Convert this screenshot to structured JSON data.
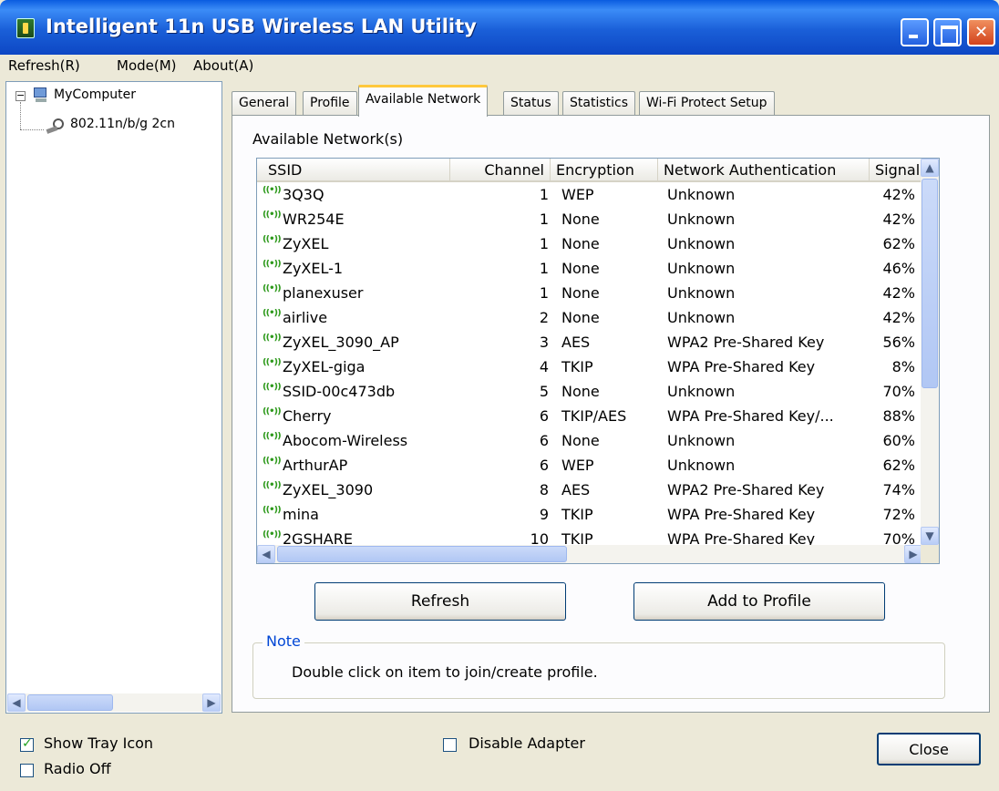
{
  "window": {
    "title": "Intelligent 11n USB Wireless LAN Utility"
  },
  "menu": {
    "items": [
      "Refresh(R)",
      "Mode(M)",
      "About(A)"
    ]
  },
  "tree": {
    "root_label": "MyComputer",
    "adapter_label": "802.11n/b/g 2cn",
    "expander_symbol": "−"
  },
  "tabs": [
    {
      "label": "General",
      "active": false
    },
    {
      "label": "Profile",
      "active": false
    },
    {
      "label": "Available Network",
      "active": true
    },
    {
      "label": "Status",
      "active": false
    },
    {
      "label": "Statistics",
      "active": false
    },
    {
      "label": "Wi-Fi Protect Setup",
      "active": false
    }
  ],
  "available": {
    "section_title": "Available Network(s)",
    "columns": [
      "SSID",
      "Channel",
      "Encryption",
      "Network Authentication",
      "Signal"
    ],
    "rows": [
      {
        "ssid": "3Q3Q",
        "channel": "1",
        "encryption": "WEP",
        "auth": "Unknown",
        "signal": "42%"
      },
      {
        "ssid": "WR254E",
        "channel": "1",
        "encryption": "None",
        "auth": "Unknown",
        "signal": "42%"
      },
      {
        "ssid": "ZyXEL",
        "channel": "1",
        "encryption": "None",
        "auth": "Unknown",
        "signal": "62%"
      },
      {
        "ssid": "ZyXEL-1",
        "channel": "1",
        "encryption": "None",
        "auth": "Unknown",
        "signal": "46%"
      },
      {
        "ssid": "planexuser",
        "channel": "1",
        "encryption": "None",
        "auth": "Unknown",
        "signal": "42%"
      },
      {
        "ssid": "airlive",
        "channel": "2",
        "encryption": "None",
        "auth": "Unknown",
        "signal": "42%"
      },
      {
        "ssid": "ZyXEL_3090_AP",
        "channel": "3",
        "encryption": "AES",
        "auth": "WPA2 Pre-Shared Key",
        "signal": "56%"
      },
      {
        "ssid": "ZyXEL-giga",
        "channel": "4",
        "encryption": "TKIP",
        "auth": "WPA Pre-Shared Key",
        "signal": "8%"
      },
      {
        "ssid": "SSID-00c473db",
        "channel": "5",
        "encryption": "None",
        "auth": "Unknown",
        "signal": "70%"
      },
      {
        "ssid": "Cherry",
        "channel": "6",
        "encryption": "TKIP/AES",
        "auth": "WPA Pre-Shared Key/...",
        "signal": "88%"
      },
      {
        "ssid": "Abocom-Wireless",
        "channel": "6",
        "encryption": "None",
        "auth": "Unknown",
        "signal": "60%"
      },
      {
        "ssid": "ArthurAP",
        "channel": "6",
        "encryption": "WEP",
        "auth": "Unknown",
        "signal": "62%"
      },
      {
        "ssid": "ZyXEL_3090",
        "channel": "8",
        "encryption": "AES",
        "auth": "WPA2 Pre-Shared Key",
        "signal": "74%"
      },
      {
        "ssid": "mina",
        "channel": "9",
        "encryption": "TKIP",
        "auth": "WPA Pre-Shared Key",
        "signal": "72%"
      },
      {
        "ssid": "2GSHARE",
        "channel": "10",
        "encryption": "TKIP",
        "auth": "WPA Pre-Shared Key",
        "signal": "70%"
      }
    ],
    "refresh_label": "Refresh",
    "add_profile_label": "Add to Profile",
    "note_title": "Note",
    "note_text": "Double click on item to join/create profile."
  },
  "footer": {
    "show_tray_icon_label": "Show Tray Icon",
    "show_tray_icon_checked": true,
    "radio_off_label": "Radio Off",
    "radio_off_checked": false,
    "disable_adapter_label": "Disable Adapter",
    "disable_adapter_checked": false,
    "close_label": "Close"
  },
  "colors": {
    "titlebar": "#1a5fd8",
    "note_title": "#0046d5",
    "wifi_icon": "#2f9a1d",
    "active_tab_accent": "#ffc83c"
  }
}
